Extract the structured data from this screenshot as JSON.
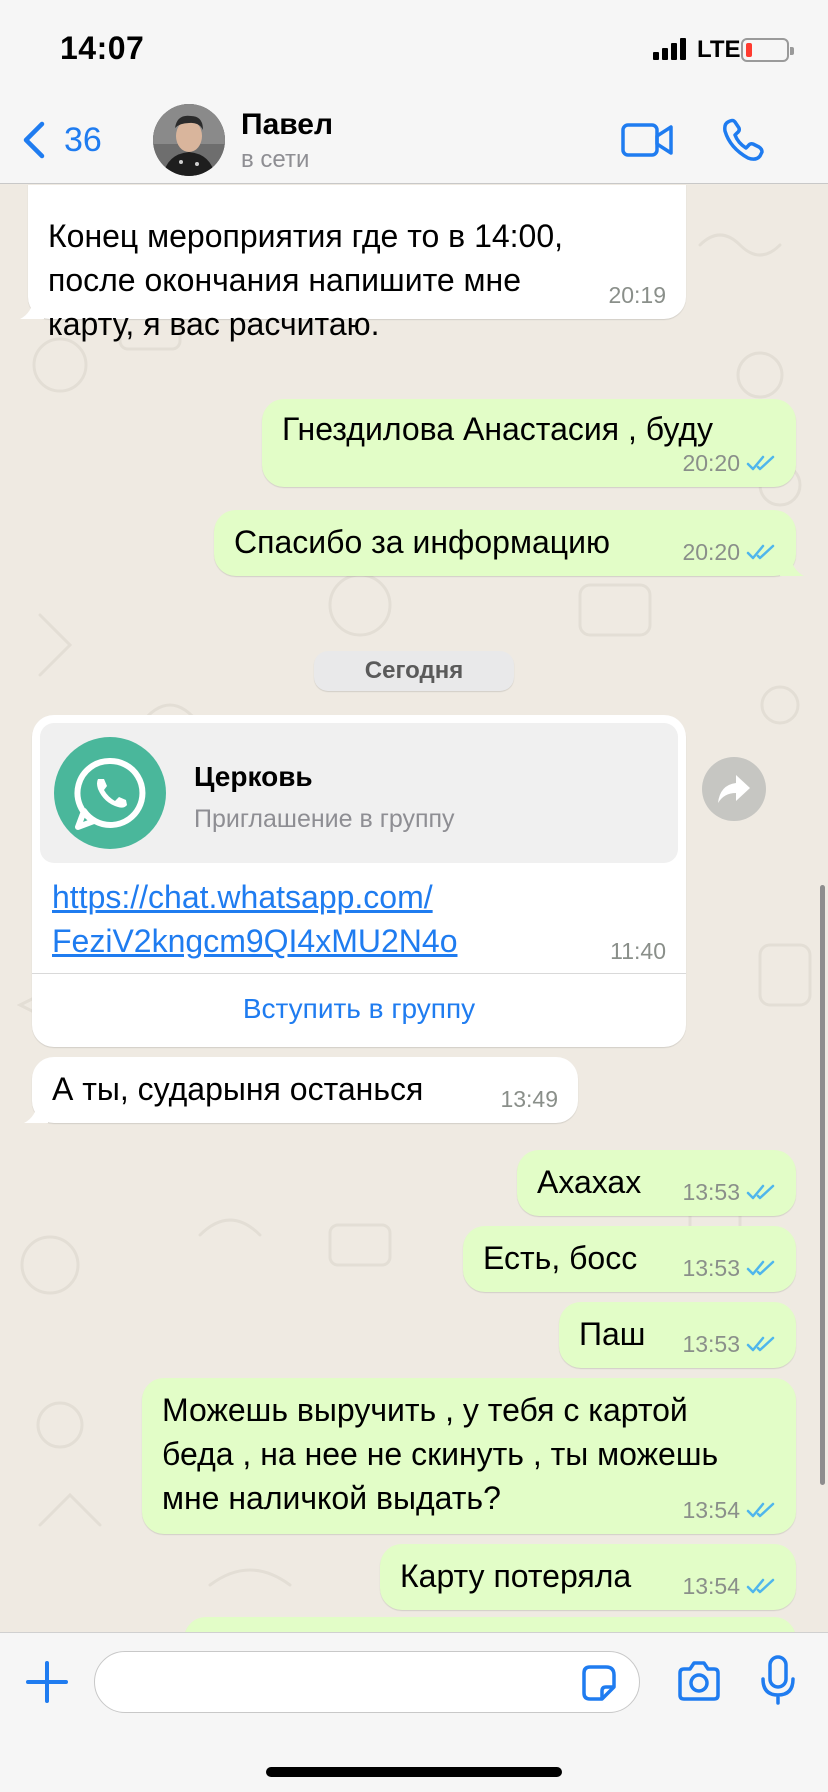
{
  "status_bar": {
    "time": "14:07",
    "network": "LTE"
  },
  "header": {
    "back_count": "36",
    "contact_name": "Павел",
    "contact_status": "в сети"
  },
  "messages": [
    {
      "dir": "in",
      "lines": [
        "Конец мероприятия где то в 14:00,",
        "после окончания напишите мне",
        "карту, я вас расчитаю."
      ],
      "time": "20:19"
    },
    {
      "dir": "out",
      "text": "Гнездилова Анастасия , буду",
      "time": "20:20"
    },
    {
      "dir": "out",
      "text": "Спасибо за информацию",
      "time": "20:20"
    },
    {
      "dir": "in",
      "text": "А ты, сударыня останься",
      "time": "13:49"
    },
    {
      "dir": "out",
      "text": "Ахахах",
      "time": "13:53"
    },
    {
      "dir": "out",
      "text": "Есть, босс",
      "time": "13:53"
    },
    {
      "dir": "out",
      "text": "Паш",
      "time": "13:53"
    },
    {
      "dir": "out",
      "lines": [
        "Можешь выручить , у тебя с картой",
        "беда , на нее не скинуть , ты можешь",
        "мне наличкой выдать?"
      ],
      "time": "13:54"
    },
    {
      "dir": "out",
      "text": "Карту потеряла",
      "time": "13:54"
    }
  ],
  "date_separator": "Сегодня",
  "invite": {
    "title": "Церковь",
    "subtitle": "Приглашение в группу",
    "link_lines": [
      "https://chat.whatsapp.com/",
      "FeziV2kngcm9QI4xMU2N4o"
    ],
    "time": "11:40",
    "join_label": "Вступить в группу"
  },
  "input": {
    "placeholder": "",
    "value": ""
  },
  "colors": {
    "outgoing_bubble": "#e2fdc7",
    "incoming_bubble": "#ffffff",
    "accent": "#1f7cf0",
    "read_ticks": "#4fb6ec",
    "whatsapp_green": "#4ab79b",
    "chat_background": "#efeae2"
  },
  "icons": [
    "back-chevron-icon",
    "video-call-icon",
    "phone-call-icon",
    "forward-icon",
    "whatsapp-logo-icon",
    "plus-icon",
    "sticker-icon",
    "camera-icon",
    "microphone-icon",
    "read-ticks-icon"
  ]
}
